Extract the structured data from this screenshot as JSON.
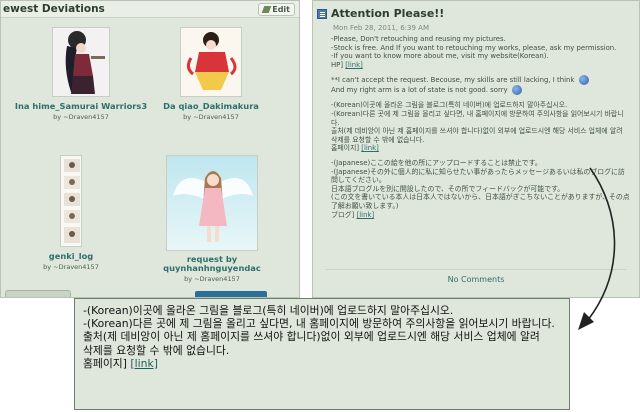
{
  "left": {
    "title": "ewest Deviations",
    "edit_label": "Edit",
    "items": [
      {
        "title": "Ina hime_Samurai Warriors3",
        "by": "by ~Draven4157"
      },
      {
        "title": "Da qiao_Dakimakura",
        "by": "by ~Draven4157"
      },
      {
        "title": "genki_log",
        "by": "by ~Draven4157"
      },
      {
        "title": "request by quynhanhnguyendac",
        "by": "by ~Draven4157"
      }
    ]
  },
  "right": {
    "title": "Attention Please!!",
    "date": "Mon Feb 28, 2011, 6:39 AM",
    "lines": {
      "p1a": "-Please, Don't retouching and reusing my pictures.",
      "p1b": "-Stock is free. And If you want to retouching my works, please, ask my permission.",
      "p1c": "-If you want to know more about me, visit my website(Korean).",
      "p1d": "HP]",
      "p2a": "**I can't accept the request. Becouse, my skills are still lacking, I think",
      "p2b": "And my right arm is a lot of state is not good. sorry",
      "ko1": "-(Korean)이곳에 올라온 그림을 블로그(특히 네이버)에 업로드하지 말아주십시오.",
      "ko2": "-(Korean)다른 곳에 제 그림을 올리고 싶다면, 내 홈페이지에 방문하여 주의사항을 읽어보시기 바랍니다.",
      "ko3": "출처(제 데비앙이 아닌 제 홈페이지를 쓰셔야 합니다)없이 외부에 업로드시엔 해당 서비스 업체에 알려",
      "ko4": "삭제를 요청할 수 밖에 없습니다.",
      "ko5": "홈페이지]",
      "ja1": "-(Japanese)ここの絵を他の所にアップロードすることは禁止です。",
      "ja2": "-(Japanese)その外に個人的に私に知らせたい事があったらメッセージあるいは私のブログに訪問してください。",
      "ja3": "日本語ブログルを別に開設したので、その所でフィードバックが可能です。",
      "ja4": "(この文を書いている本人は日本人ではないから、日本語がぎこちないことがありますが、その点了解お願い致します。)",
      "ja5": "ブログ]"
    },
    "link_label": "[link]",
    "no_comments": "No Comments"
  },
  "zoom": {
    "l1": "-(Korean)이곳에 올라온 그림을 블로그(특히 네이버)에 업로드하지 말아주십시오.",
    "l2": "-(Korean)다른 곳에 제 그림을 올리고 싶다면, 내 홈페이지에 방문하여 주의사항을 읽어보시기 바랍니다.",
    "l3": "출처(제 데비앙이 아닌 제 홈페이지를 쓰셔야 합니다)없이 외부에 업로드시엔 해당 서비스 업체에 알려",
    "l4": "삭제를 요청할 수 밖에 없습니다.",
    "l5": "홈페이지]",
    "link_label": "[link]"
  },
  "colors": {
    "panel_bg": "#dfe7dc",
    "link": "#2f6f6a",
    "accent_blue": "#2b6f99"
  }
}
